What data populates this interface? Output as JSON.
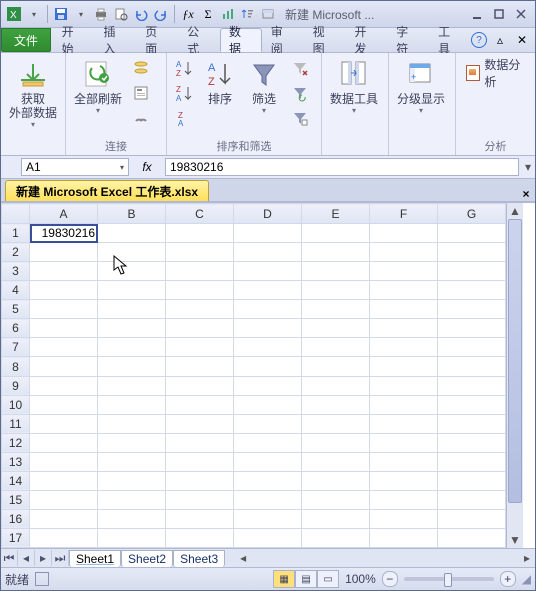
{
  "title": "新建 Microsoft ...",
  "qat": {
    "save": "save-icon",
    "print": "print-icon",
    "undo": "undo-icon",
    "redo": "redo-icon"
  },
  "menubar": {
    "file": "文件",
    "tabs": [
      "开始",
      "插入",
      "页面",
      "公式",
      "数据",
      "审阅",
      "视图",
      "开发",
      "字符",
      "工具"
    ],
    "active_index": 4
  },
  "ribbon": {
    "groups": {
      "get_data": {
        "label": "获取\n外部数据"
      },
      "connections": {
        "refresh": "全部刷新",
        "label": "连接"
      },
      "sort_filter": {
        "sort": "排序",
        "filter": "筛选",
        "label": "排序和筛选"
      },
      "data_tools": {
        "label_line1": "数据工具"
      },
      "outline": {
        "label_line1": "分级显示"
      },
      "analysis": {
        "btn": "数据分析",
        "label": "分析"
      }
    }
  },
  "formula_bar": {
    "name": "A1",
    "fx": "fx",
    "value": "19830216"
  },
  "workbook_tab": "新建 Microsoft Excel 工作表.xlsx",
  "sheet": {
    "columns": [
      "A",
      "B",
      "C",
      "D",
      "E",
      "F",
      "G"
    ],
    "rows": 17,
    "selected": {
      "row": 1,
      "col": 0
    },
    "cells": {
      "A1": "19830216"
    },
    "tabs": [
      "Sheet1",
      "Sheet2",
      "Sheet3"
    ],
    "active_tab": 0
  },
  "status": {
    "ready": "就绪",
    "zoom": "100%"
  },
  "chart_data": null
}
